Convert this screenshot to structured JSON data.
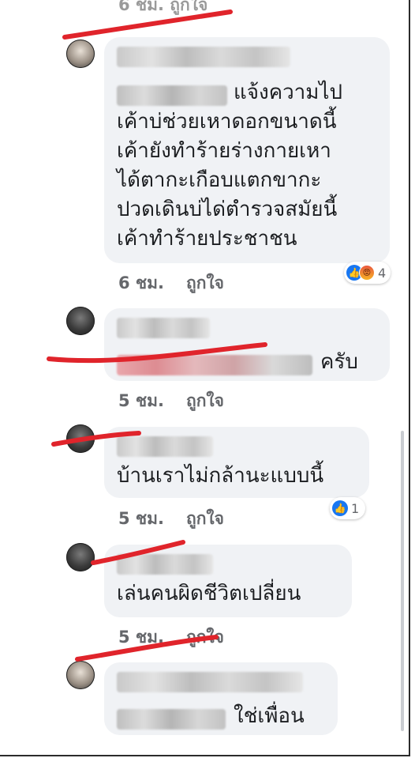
{
  "top_fragment": "6 ชม.    ถูกใจ",
  "comments": [
    {
      "message_tail": "แจ้งความไป\nเค้าบ่ช่วยเหาดอกขนาดนี้\nเค้ายังทำร้ายร่างกายเหา\nได้ตากะเกือบแตกขากะ\nปวดเดินบ่ได่ตำรวจสมัยนี้\nเค้าทำร้ายประชาชน",
      "time": "6 ชม.",
      "like_label": "ถูกใจ",
      "reaction_count": "4"
    },
    {
      "message_tail": "ครับ",
      "time": "5 ชม.",
      "like_label": "ถูกใจ"
    },
    {
      "message": "บ้านเราไม่กล้านะแบบนี้",
      "time": "5 ชม.",
      "like_label": "ถูกใจ",
      "reaction_count": "1"
    },
    {
      "message": "เล่นคนผิดชีวิตเปลี่ยน",
      "time": "5 ชม.",
      "like_label": "ถูกใจ"
    },
    {
      "message_tail": "ใช่เพื่อน"
    }
  ],
  "icons": {
    "like": "thumbs-up-icon",
    "angry": "angry-face-icon"
  },
  "colors": {
    "bubble": "#f0f2f5",
    "like_blue": "#1877f2",
    "annotation_red": "#e0242b",
    "meta_gray": "#65676b"
  }
}
